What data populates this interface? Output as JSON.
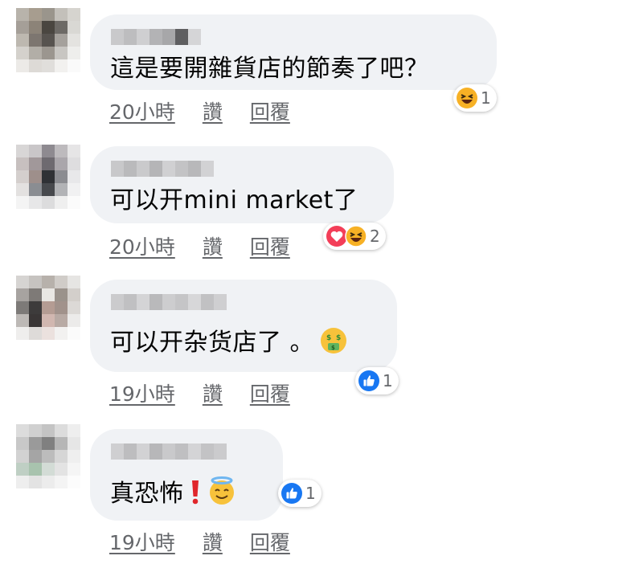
{
  "comments": [
    {
      "text": "這是要開雜貨店的節奏了吧？",
      "time": "20小時",
      "like_label": "讚",
      "reply_label": "回覆",
      "reaction_count": "1",
      "reactions": [
        "haha-icon"
      ]
    },
    {
      "text": "可以开mini market了",
      "time": "20小時",
      "like_label": "讚",
      "reply_label": "回覆",
      "reaction_count": "2",
      "reactions": [
        "love-icon",
        "haha-icon"
      ]
    },
    {
      "text": "可以开杂货店了 。",
      "inline_emoji": "money-mouth-face-icon",
      "time": "19小時",
      "like_label": "讚",
      "reply_label": "回覆",
      "reaction_count": "1",
      "reactions": [
        "like-icon"
      ]
    },
    {
      "text": "真恐怖",
      "inline_emoji": [
        "red-exclamation-icon",
        "smiling-halo-face-icon"
      ],
      "time": "19小時",
      "like_label": "讚",
      "reply_label": "回覆",
      "reaction_count": "1",
      "reactions": [
        "like-icon"
      ]
    }
  ],
  "colors": {
    "bubble": "#f0f2f5",
    "meta_text": "#65676b",
    "like_blue": "#1877f2",
    "love_red": "#f33e58",
    "haha_yellow": "#f7b125"
  }
}
